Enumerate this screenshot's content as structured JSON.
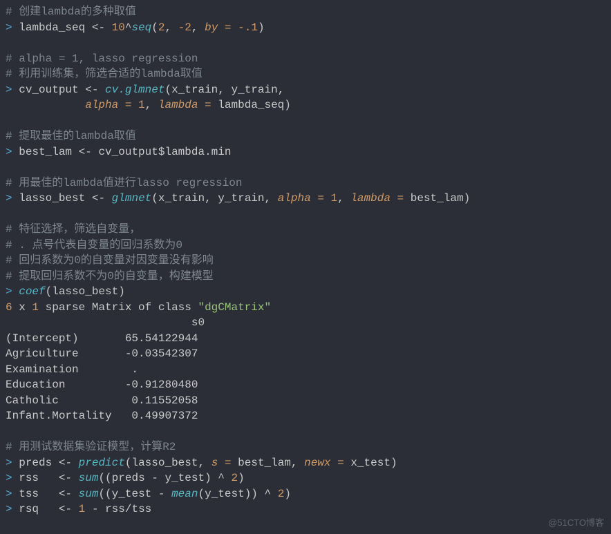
{
  "prompt": ">",
  "comments": {
    "c1": "# 创建lambda的多种取值",
    "c2": "# alpha = 1, lasso regression",
    "c3": "# 利用训练集，筛选合适的lambda取值",
    "c4": "# 提取最佳的lambda取值",
    "c5": "# 用最佳的lambda值进行lasso regression",
    "c6": "# 特征选择，筛选自变量，",
    "c7": "# . 点号代表自变量的回归系数为0",
    "c8": "# 回归系数为0的自变量对因变量没有影响",
    "c9": "# 提取回归系数不为0的自变量，构建模型",
    "c10": "# 用测试数据集验证模型，计算R2"
  },
  "code": {
    "l1_id": "lambda_seq ",
    "l1_op": "<-",
    "l1_num1": " 10",
    "l1_caret": "^",
    "l1_fn": "seq",
    "l1_lp": "(",
    "l1_arg1": "2",
    "l1_comma1": ", ",
    "l1_arg2": "-2",
    "l1_comma2": ", ",
    "l1_kwarg": "by = ",
    "l1_arg3": "-.1",
    "l1_rp": ")",
    "l2_id": "cv_output ",
    "l2_op": "<-",
    "l2_sp": " ",
    "l2_fn": "cv.glmnet",
    "l2_lp": "(x_train, y_train,",
    "l2_cont_pad": "            ",
    "l2b_kw1": "alpha = ",
    "l2b_v1": "1",
    "l2b_comma": ", ",
    "l2b_kw2": "lambda = ",
    "l2b_v2": "lambda_seq)",
    "l3_id": "best_lam ",
    "l3_op": "<-",
    "l3_rhs": " cv_output",
    "l3_dollar": "$",
    "l3_member": "lambda.min",
    "l4_id": "lasso_best ",
    "l4_op": "<-",
    "l4_sp": " ",
    "l4_fn": "glmnet",
    "l4_lp": "(x_train, y_train, ",
    "l4_kw1": "alpha = ",
    "l4_v1": "1",
    "l4_comma": ", ",
    "l4_kw2": "lambda = ",
    "l4_v2": "best_lam)",
    "l5_fn": "coef",
    "l5_args": "(lasso_best)",
    "o_head_a": "6",
    "o_head_b": " x ",
    "o_head_c": "1",
    "o_head_d": " sparse Matrix of class ",
    "o_head_e": "\"dgCMatrix\"",
    "o_col_header": "                            s0",
    "o_r1": "(Intercept)       65.54122944",
    "o_r2": "Agriculture       -0.03542307",
    "o_r3": "Examination        .         ",
    "o_r4": "Education         -0.91280480",
    "o_r5": "Catholic           0.11552058",
    "o_r6": "Infant.Mortality   0.49907372",
    "l6_id": "preds ",
    "l6_op": "<-",
    "l6_sp": " ",
    "l6_fn": "predict",
    "l6_lp": "(lasso_best, ",
    "l6_kw": "s = ",
    "l6_v": "best_lam, ",
    "l6_kw2": "newx = ",
    "l6_v2": "x_test)",
    "l7_id": "rss   ",
    "l7_op": "<-",
    "l7_sp": " ",
    "l7_fn": "sum",
    "l7_args_a": "((preds - y_test) ^ ",
    "l7_num": "2",
    "l7_args_b": ")",
    "l8_id": "tss   ",
    "l8_op": "<-",
    "l8_sp": " ",
    "l8_fn": "sum",
    "l8_args_a": "((y_test - ",
    "l8_fn2": "mean",
    "l8_args_b": "(y_test)) ^ ",
    "l8_num": "2",
    "l8_args_c": ")",
    "l9_id": "rsq   ",
    "l9_op": "<-",
    "l9_sp": " ",
    "l9_num": "1",
    "l9_rest": " - rss/tss"
  },
  "watermark": "@51CTO博客"
}
